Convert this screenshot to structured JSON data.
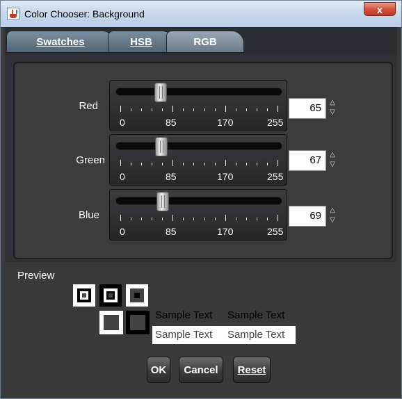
{
  "window": {
    "title": "Color Chooser: Background",
    "close_label": "x"
  },
  "tabs": [
    {
      "label": "Swatches",
      "selected": false
    },
    {
      "label": "HSB",
      "selected": false
    },
    {
      "label": "RGB",
      "selected": true
    }
  ],
  "sliders": [
    {
      "label": "Red",
      "value_text": "65",
      "value": 65,
      "max": 255
    },
    {
      "label": "Green",
      "value_text": "67",
      "value": 67,
      "max": 255
    },
    {
      "label": "Blue",
      "value_text": "69",
      "value": 69,
      "max": 255
    }
  ],
  "tick_labels": [
    "0",
    "85",
    "170",
    "255"
  ],
  "spinner_icons": {
    "up": "arrow-up-icon",
    "down": "arrow-down-icon"
  },
  "preview": {
    "label": "Preview",
    "sample_text": "Sample Text",
    "color": "#414345"
  },
  "buttons": {
    "ok": "OK",
    "cancel": "Cancel",
    "reset": "Reset"
  }
}
